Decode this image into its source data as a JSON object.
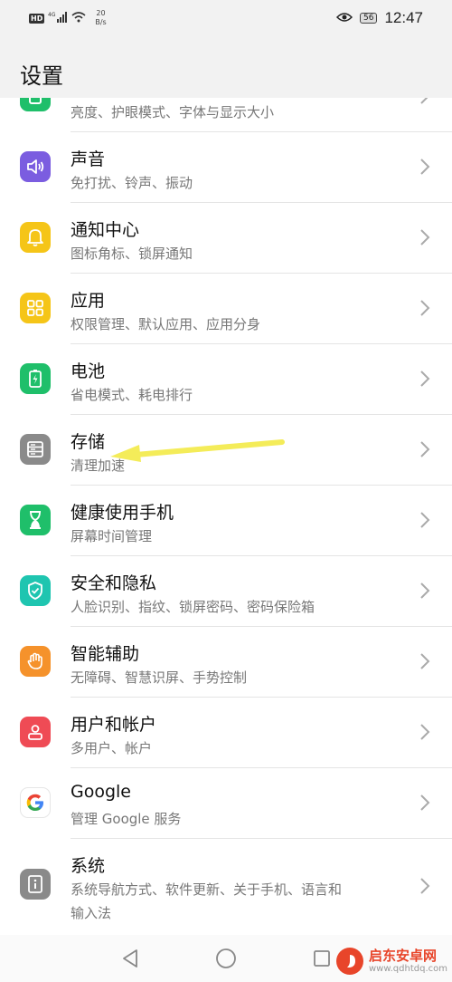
{
  "status_bar": {
    "hd": "HD",
    "signal": "4G",
    "net_rate": "20",
    "net_unit": "B/s",
    "battery": "56",
    "time": "12:47"
  },
  "header": {
    "title": "设置"
  },
  "items": [
    {
      "label": "",
      "subtitle": "亮度、护眼模式、字体与显示大小",
      "icon": "display-icon",
      "color": "#1fbf6a"
    },
    {
      "label": "声音",
      "subtitle": "免打扰、铃声、振动",
      "icon": "speaker-icon",
      "color": "#7b5de0"
    },
    {
      "label": "通知中心",
      "subtitle": "图标角标、锁屏通知",
      "icon": "bell-icon",
      "color": "#f5c518"
    },
    {
      "label": "应用",
      "subtitle": "权限管理、默认应用、应用分身",
      "icon": "apps-grid-icon",
      "color": "#f5c518"
    },
    {
      "label": "电池",
      "subtitle": "省电模式、耗电排行",
      "icon": "battery-icon",
      "color": "#1fbf6a"
    },
    {
      "label": "存储",
      "subtitle": "清理加速",
      "icon": "storage-icon",
      "color": "#8a8a8a"
    },
    {
      "label": "健康使用手机",
      "subtitle": "屏幕时间管理",
      "icon": "hourglass-icon",
      "color": "#1fbf6a"
    },
    {
      "label": "安全和隐私",
      "subtitle": "人脸识别、指纹、锁屏密码、密码保险箱",
      "icon": "shield-icon",
      "color": "#1fc5b0"
    },
    {
      "label": "智能辅助",
      "subtitle": "无障碍、智慧识屏、手势控制",
      "icon": "hand-icon",
      "color": "#f5922b"
    },
    {
      "label": "用户和帐户",
      "subtitle": "多用户、帐户",
      "icon": "user-icon",
      "color": "#ef4b55"
    },
    {
      "label": "Google",
      "subtitle": "管理 Google 服务",
      "icon": "google-icon",
      "color": "#ffffff"
    },
    {
      "label": "系统",
      "subtitle": "系统导航方式、软件更新、关于手机、语言和",
      "subtitle2": "输入法",
      "icon": "info-icon",
      "color": "#8a8a8a"
    }
  ],
  "watermark": {
    "brand": "启东安卓网",
    "url": "www.qdhtdq.com"
  }
}
